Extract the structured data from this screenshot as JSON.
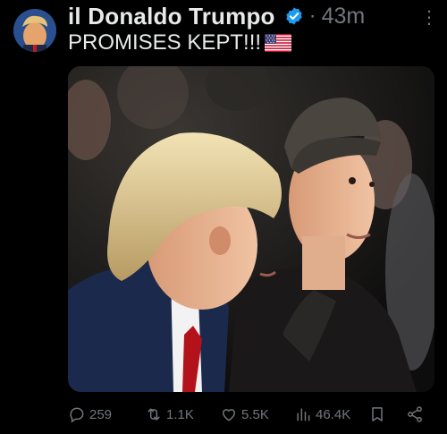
{
  "author": {
    "display_name": "il Donaldo Trumpo",
    "verified": true,
    "avatar_icon": "profile-avatar",
    "time": "43m",
    "separator": "·"
  },
  "post": {
    "text": "PROMISES KEPT!!!",
    "emoji": "us-flag-emoji",
    "media": "photo of two men seated in a crowd"
  },
  "actions": {
    "replies": "259",
    "reposts": "1.1K",
    "likes": "5.5K",
    "views": "46.4K"
  },
  "colors": {
    "background": "#000000",
    "text": "#e7e9ea",
    "muted": "#71767b",
    "verified": "#1d9bf0"
  }
}
